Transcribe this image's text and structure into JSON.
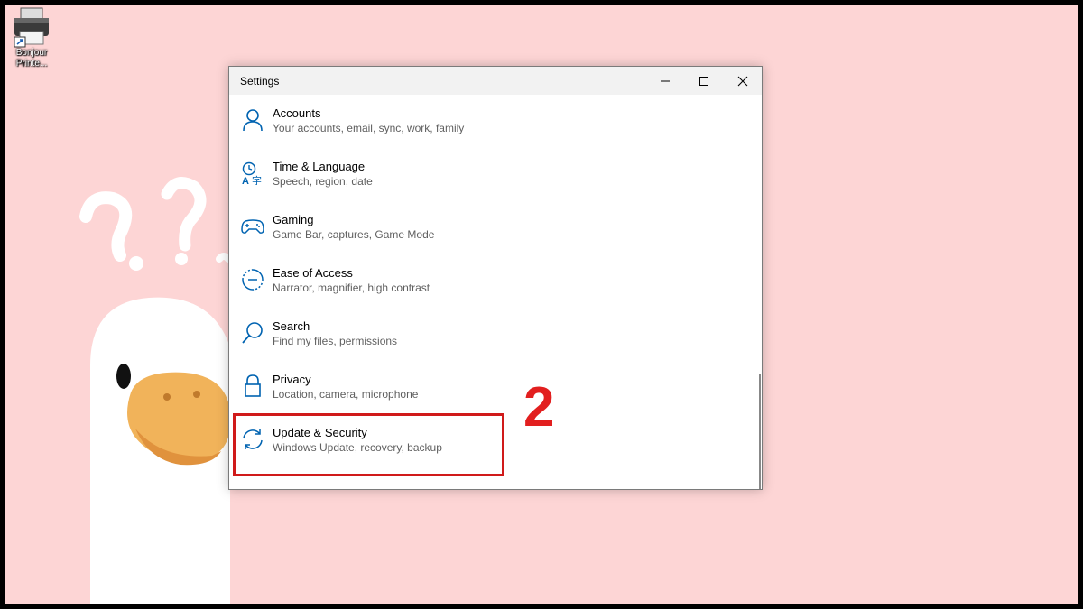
{
  "desktop": {
    "icon_label": "Bonjour Printe..."
  },
  "window": {
    "title": "Settings",
    "minimize_icon": "minimize-icon",
    "maximize_icon": "maximize-icon",
    "close_icon": "close-icon"
  },
  "settings": {
    "items": [
      {
        "name": "Accounts",
        "desc": "Your accounts, email, sync, work, family",
        "icon": "person-icon"
      },
      {
        "name": "Time & Language",
        "desc": "Speech, region, date",
        "icon": "time-language-icon"
      },
      {
        "name": "Gaming",
        "desc": "Game Bar, captures, Game Mode",
        "icon": "gamepad-icon"
      },
      {
        "name": "Ease of Access",
        "desc": "Narrator, magnifier, high contrast",
        "icon": "ease-of-access-icon"
      },
      {
        "name": "Search",
        "desc": "Find my files, permissions",
        "icon": "search-icon"
      },
      {
        "name": "Privacy",
        "desc": "Location, camera, microphone",
        "icon": "lock-icon"
      },
      {
        "name": "Update & Security",
        "desc": "Windows Update, recovery, backup",
        "icon": "sync-icon"
      }
    ]
  },
  "annotation": {
    "step_number": "2",
    "color": "#d01a1a"
  },
  "colors": {
    "accent": "#0063b1",
    "wallpaper": "#fdd5d5"
  }
}
